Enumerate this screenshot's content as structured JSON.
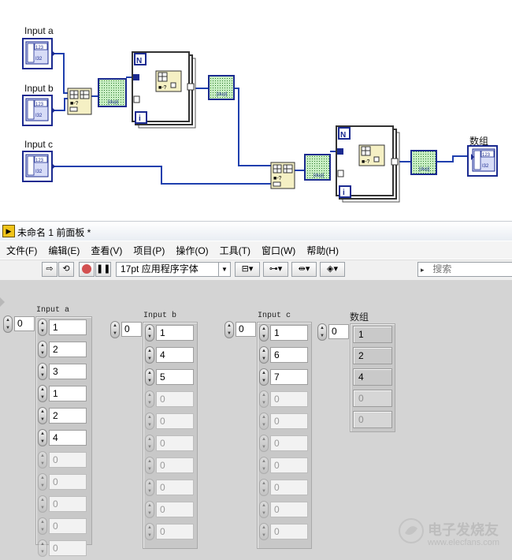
{
  "diagram": {
    "labels": {
      "input_a": "Input a",
      "input_b": "Input b",
      "input_c": "Input c",
      "output": "数组"
    },
    "terminal_text": "123",
    "loop_count_label": "N",
    "loop_index_label": "i",
    "dup_label": "[dup]"
  },
  "window": {
    "title": "未命名 1 前面板 *"
  },
  "menu": {
    "items": [
      "文件(F)",
      "编辑(E)",
      "查看(V)",
      "项目(P)",
      "操作(O)",
      "工具(T)",
      "窗口(W)",
      "帮助(H)"
    ]
  },
  "toolbar": {
    "font": "17pt 应用程序字体",
    "search_placeholder": "搜索"
  },
  "panel": {
    "arrays": [
      {
        "label": "Input a",
        "index": "0",
        "values": [
          "1",
          "2",
          "3",
          "1",
          "2",
          "4",
          "0",
          "0",
          "0",
          "0",
          "0"
        ],
        "active": 6
      },
      {
        "label": "Input b",
        "index": "0",
        "values": [
          "1",
          "4",
          "5",
          "0",
          "0",
          "0",
          "0",
          "0",
          "0",
          "0"
        ],
        "active": 3
      },
      {
        "label": "Input c",
        "index": "0",
        "values": [
          "1",
          "6",
          "7",
          "0",
          "0",
          "0",
          "0",
          "0",
          "0",
          "0"
        ],
        "active": 3
      }
    ],
    "output": {
      "label": "数组",
      "index": "0",
      "values": [
        "1",
        "2",
        "4",
        "0",
        "0"
      ],
      "active": 3
    }
  },
  "watermark": {
    "line1": "电子发烧友",
    "line2": "www.elecfans.com"
  },
  "colors": {
    "wire": "#1f3fae",
    "loop_blue": "#1a2a90",
    "panel_bg": "#d4d4d4"
  }
}
